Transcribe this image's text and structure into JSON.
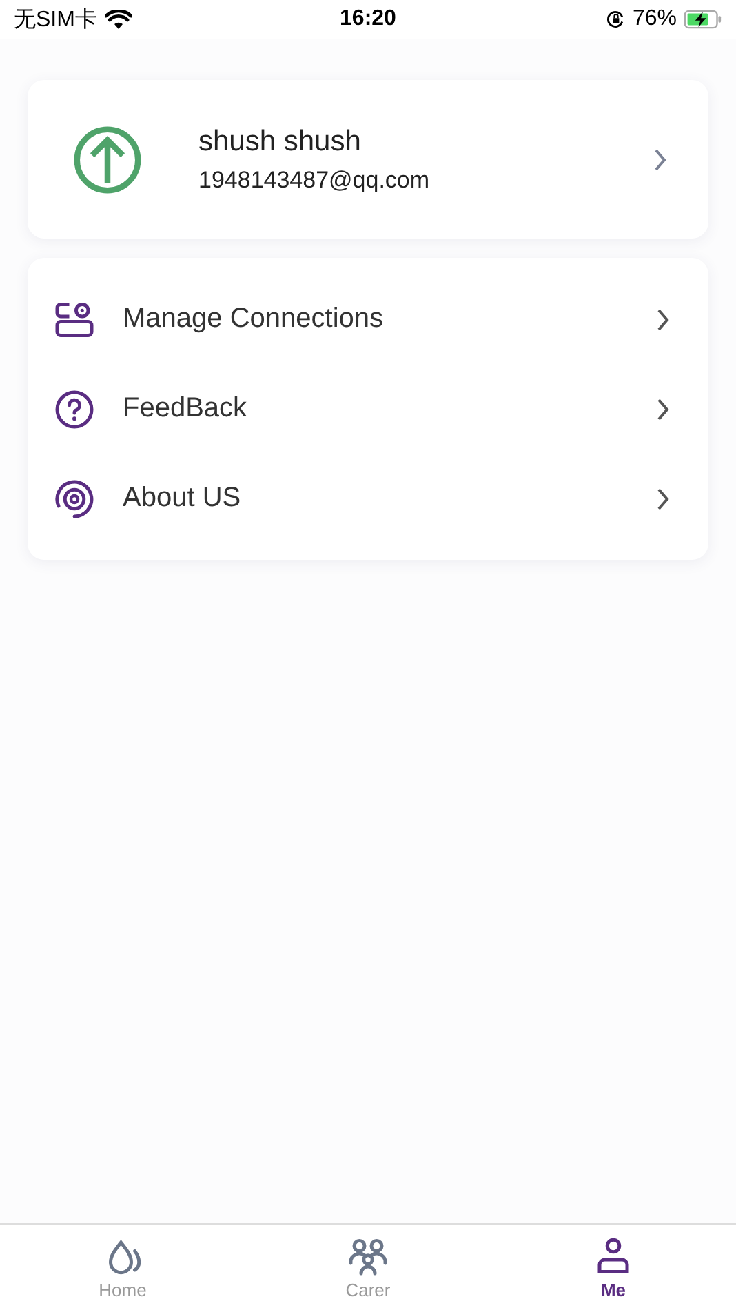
{
  "status_bar": {
    "carrier": "无SIM卡",
    "time": "16:20",
    "battery": "76%"
  },
  "profile": {
    "name": "shush shush",
    "email": "1948143487@qq.com"
  },
  "menu": [
    {
      "kind": "connections",
      "label": "Manage Connections"
    },
    {
      "kind": "feedback",
      "label": "FeedBack"
    },
    {
      "kind": "about",
      "label": "About US"
    }
  ],
  "tabs": [
    {
      "kind": "home",
      "label": "Home",
      "selected": false
    },
    {
      "kind": "carer",
      "label": "Carer",
      "selected": false
    },
    {
      "kind": "me",
      "label": "Me",
      "selected": true
    }
  ]
}
